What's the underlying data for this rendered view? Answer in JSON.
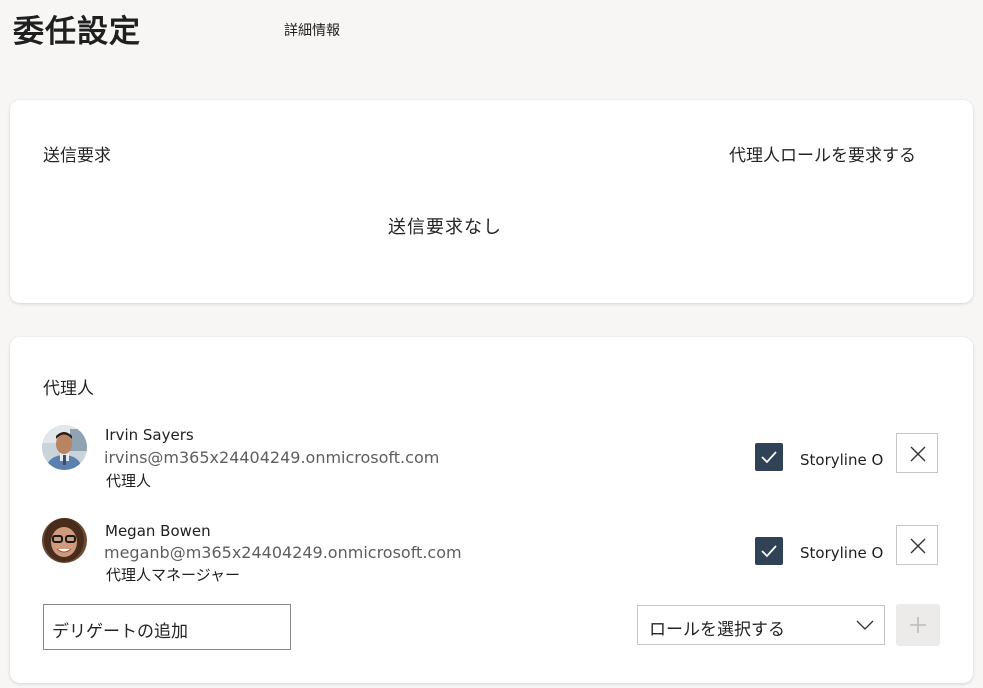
{
  "page": {
    "title": "委任設定",
    "details_link": "詳細情報"
  },
  "requests": {
    "sent_label": "送信要求",
    "request_role_link": "代理人ロールを要求する",
    "empty_message": "送信要求なし"
  },
  "delegates": {
    "section_label": "代理人",
    "items": [
      {
        "name": "Irvin Sayers",
        "email": "irvins@m365x24404249.onmicrosoft.com",
        "role": "代理人",
        "checked": true,
        "option_label": "Storyline O",
        "avatar_icon": "avatar-photo"
      },
      {
        "name": "Megan Bowen",
        "email": "meganb@m365x24404249.onmicrosoft.com",
        "role": "代理人マネージャー",
        "checked": true,
        "option_label": "Storyline O",
        "avatar_icon": "avatar-photo"
      }
    ],
    "add_input_value": "デリゲートの追加",
    "role_select_label": "ロールを選択する",
    "add_button_icon": "plus-icon",
    "remove_icon": "close-icon"
  },
  "colors": {
    "background": "#f7f6f4",
    "checkbox": "#2f4256",
    "secondary_text": "#605e5c"
  }
}
